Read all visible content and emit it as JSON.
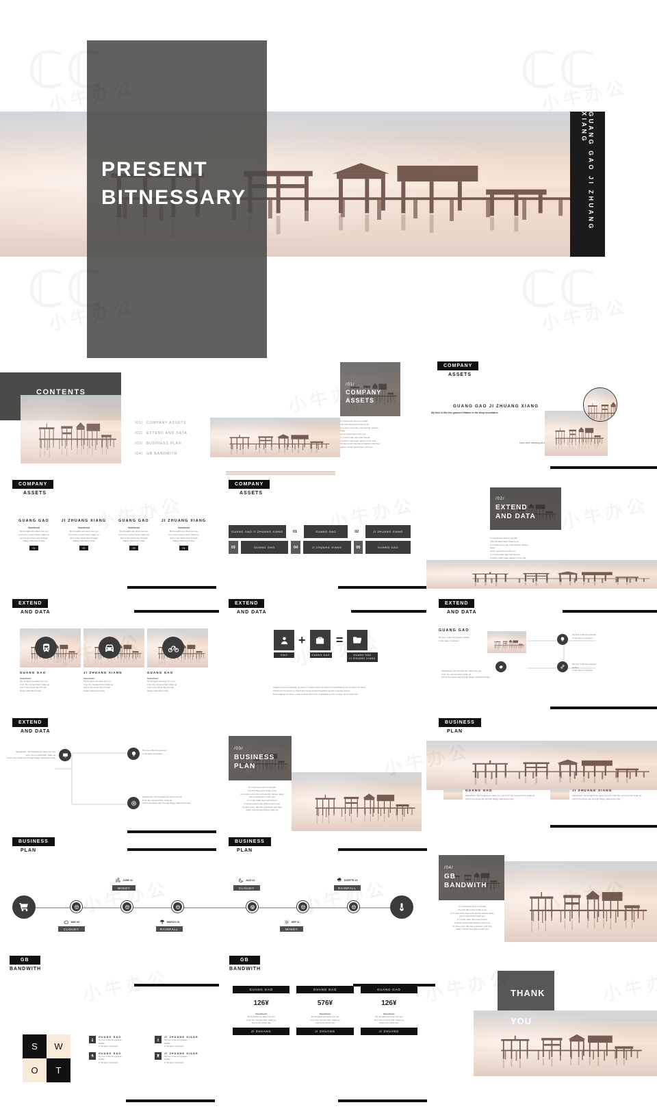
{
  "deck": {
    "title_main": "PRESENT",
    "title_sub": "BITNESSARY",
    "vertical_strip": "GUANG GAO JI ZHUANG XIANG"
  },
  "contents": {
    "heading": "CONTENTS",
    "items": [
      {
        "num": "/01/",
        "label": "COMPANY ASSETS"
      },
      {
        "num": "/02/",
        "label": "EXTEND AND DATA"
      },
      {
        "num": "/03/",
        "label": "BUSINESS PLAN"
      },
      {
        "num": "/04/",
        "label": "GB BANDWITH"
      }
    ]
  },
  "sections": {
    "s1": {
      "num": "/01/",
      "line1": "COMPANY",
      "line2": "ASSETS"
    },
    "s2": {
      "num": "/02/",
      "line1": "EXTEND",
      "line2": "AND DATA"
    },
    "s3": {
      "num": "/03/",
      "line1": "BUSINESS",
      "line2": "PLAN"
    },
    "s4": {
      "num": "/04/",
      "line1": "GB",
      "line2": "BANDWITH"
    }
  },
  "tags": {
    "company": {
      "top": "COMPANY",
      "bottom": "ASSETS"
    },
    "extend": {
      "top": "EXTEND",
      "bottom": "AND DATA"
    },
    "business": {
      "top": "BUSINESS",
      "bottom": "PLAN"
    },
    "bandwith": {
      "top": "GB",
      "bottom": "BANDWITH"
    }
  },
  "lorem": {
    "poem": "If I could save time in a bottle\nThe first thing that I'd like to do\nis to save every day until eternity passes away\njust to spend them with you\nIf I could make days last forever\nif words could make wishes come true\nI'd save every day like a treasure and then\nagain I would spend them with you",
    "sweetheart_title": "Sweetheart",
    "sweetheart_body": "My thoughts are deep into you\nFrom the moment that I wake up\nAnd to the whole day through\nHappy Valentine\\'s Day",
    "love_line": "My love is like the grasses Hidden in the deep mountains.",
    "love_short": "My love is like the grasses Hidden\nin the deep mountains.",
    "thanks": "Thank you for comforting me when I'm sad Loving me when I'm mad Picking me up when I'm down\nThank you for being my friend and being around Teaching me the meaning of love\nEncouraging me when I need a shove But most of all thank you for Loving me for who I am"
  },
  "assets_right": {
    "title": "GUANG GAO JI ZHUANG XIANG",
    "bullets": [
      "It's your loving and your",
      "And knowing that you're",
      "That gentle touch you have",
      "Make my troubles disappear"
    ],
    "footer": "have been sleeping all alone, You have been staring in my dreams.\nI want to kiss you, my baby.\nI want to kiss you tonight."
  },
  "four_cols": {
    "headings": [
      "GUANG GAO",
      "JI ZHUANG XIANG",
      "GUANG GAO",
      "JI ZHUANG XIANG"
    ],
    "badges": [
      "01",
      "02",
      "03",
      "04"
    ]
  },
  "matrix": {
    "rows": [
      [
        {
          "type": "label",
          "text": "GUANG GAO JI ZHUANG XIANG"
        },
        {
          "type": "num",
          "text": "01"
        },
        {
          "type": "label",
          "text": "GUANG GAO"
        },
        {
          "type": "num",
          "text": "02"
        },
        {
          "type": "label",
          "text": "JI ZHUANG XIANG"
        }
      ],
      [
        {
          "type": "num",
          "text": "03"
        },
        {
          "type": "label",
          "text": "GUANG GAO"
        },
        {
          "type": "num",
          "text": "04"
        },
        {
          "type": "label",
          "text": "JI ZHUANG XIANG"
        },
        {
          "type": "num",
          "text": "05"
        },
        {
          "type": "label",
          "text": "GUANG GAO"
        }
      ]
    ]
  },
  "transport": {
    "cards": [
      {
        "icon": "train-icon",
        "caption": "GUANG GAO"
      },
      {
        "icon": "car-icon",
        "caption": "JI ZHUANG XIANG"
      },
      {
        "icon": "bicycle-icon",
        "caption": "GUANG GAO"
      }
    ]
  },
  "equation": {
    "a": {
      "icon": "user-icon",
      "label": "XIAO"
    },
    "plus": "+",
    "b": {
      "icon": "briefcase-icon",
      "label": "GUANG GAO"
    },
    "equals": "=",
    "c": {
      "icon": "folder-icon",
      "label": "GUANG GAO\nJI ZHUANG XIANG"
    }
  },
  "node_diagram": {
    "heading": "GUANG GAO",
    "intro": "My love is like the grasses Hidden\nin the deep mountains",
    "nodes": [
      "lightbulb-icon",
      "shopping-bag-icon",
      "megaphone-icon",
      "gear-icon",
      "link-icon",
      "screen-icon",
      "target-icon"
    ],
    "notes": [
      "My love is like the grasses\nin the deep mountains",
      "Sweetheart : My thoughts are deep into you\nFrom the moment that I wake up\nAnd to the whole day through Happy Valentine\\'s Day",
      "My love is like the grasses\nHidden\nin the deep mountains."
    ]
  },
  "two_cards": [
    {
      "heading": "GUANG GAO",
      "body": "Sweetheart: My thoughts are deep into you From the moment that I wake up\nAnd to the whole day through Happy Valentine\\'s Day"
    },
    {
      "heading": "JI ZHUANG XIANG",
      "body": "Sweetheart: My thoughts are deep into you From the moment that I wake up\nAnd to the whole day through Happy Valentine\\'s Day"
    }
  ],
  "timeline": {
    "above": [
      {
        "icon": "windy-icon",
        "date": "JUNE 01",
        "label": "WINDY"
      },
      {
        "icon": "moon-icon",
        "date": "AUG 22",
        "label": "CLOUDY"
      },
      {
        "icon": "rain-icon",
        "date": "DCEPTE 15",
        "label": "RAINFALL"
      }
    ],
    "below": [
      {
        "icon": "cloud-icon",
        "date": "MAY 04",
        "label": "CLOUDY"
      },
      {
        "icon": "umbrella-icon",
        "date": "MARCH 15",
        "label": "RAINFALL"
      },
      {
        "icon": "sun-icon",
        "date": "SEP 11",
        "label": "WINDY"
      }
    ],
    "start_icon": "cart-icon",
    "end_icon": "thermometer-icon",
    "mid_icons": [
      "face-icon",
      "face-icon",
      "face-icon",
      "face-icon",
      "face-icon",
      "face-icon"
    ]
  },
  "swot": {
    "cells": [
      "S",
      "W",
      "O",
      "T"
    ],
    "rows": [
      {
        "icon": "chess-pawn-icon",
        "heading": "GUANG GAO",
        "body": "My love is like the grasses\nHidden\nin the deep mountains."
      },
      {
        "icon": "chess-bishop-icon",
        "heading": "JI ZHUANG XIANG",
        "body": "My love is like the grasses\nHidden\nin the deep mountains."
      },
      {
        "icon": "chess-knight-icon",
        "heading": "GUANG GAO",
        "body": "My love is like the grasses\nHidden\nin the deep mountains."
      },
      {
        "icon": "chess-rook-icon",
        "heading": "JI ZHUANG XIANG",
        "body": "My love is like the grasses\nHidden\nin the deep mountains."
      }
    ]
  },
  "pricing": {
    "cards": [
      {
        "header": "GUANG GAO",
        "price": "126¥",
        "title": "Sweetheart",
        "body": "My thoughts are deep into you\nFrom the moment that I wake up\nAnd to the whole day",
        "footer": "JI ZHUANG"
      },
      {
        "header": "GUANG GAO",
        "price": "576¥",
        "title": "Sweetheart",
        "body": "My thoughts are deep into you\nFrom the moment that I wake up\nAnd to the whole day",
        "footer": "JI ZHUANG"
      },
      {
        "header": "GUANG GAO",
        "price": "126¥",
        "title": "Sweetheart",
        "body": "My thoughts are deep into you\nFrom the moment that I wake up\nAnd to the whole day",
        "footer": "JI ZHUANG"
      }
    ]
  },
  "thanks_slide": {
    "line1": "THANK",
    "line2": "YOU"
  },
  "colors": {
    "dark": "#4a4a48",
    "black": "#111111",
    "muted": "#7b7b7b",
    "cream": "#f7ead8"
  },
  "watermarks": [
    "小牛办公",
    "小牛办公",
    "小牛办公",
    "小牛办公",
    "小牛办公",
    "小牛办公",
    "小牛办公",
    "小牛办公",
    "小牛办公"
  ]
}
